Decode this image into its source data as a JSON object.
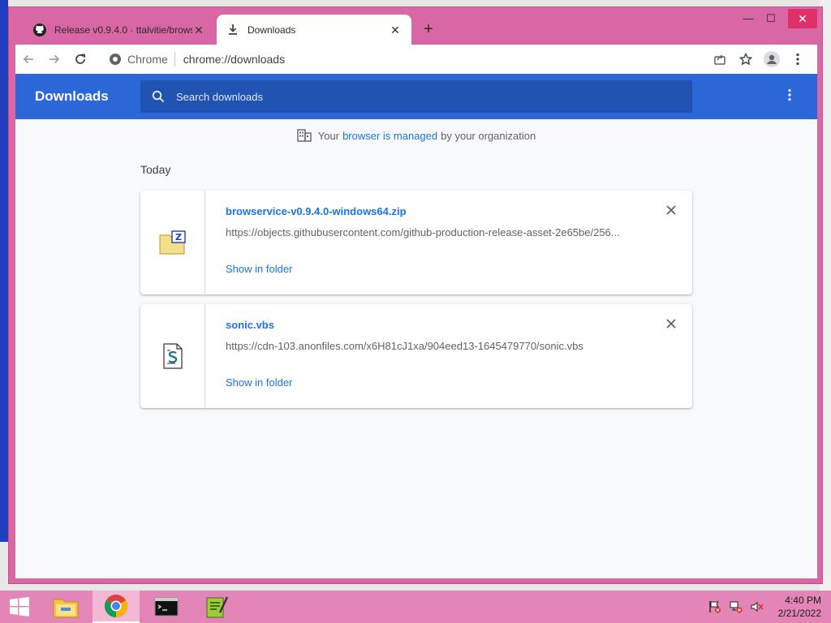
{
  "browser": {
    "tabs": [
      {
        "title": "Release v0.9.4.0 · ttalvitie/browse",
        "icon": "github-icon",
        "active": false
      },
      {
        "title": "Downloads",
        "icon": "download-icon",
        "active": true
      }
    ],
    "address": {
      "site_label": "Chrome",
      "url": "chrome://downloads"
    }
  },
  "downloads_page": {
    "title": "Downloads",
    "search_placeholder": "Search downloads",
    "managed_notice": {
      "prefix": "Your",
      "link": "browser is managed",
      "suffix": "by your organization"
    },
    "date_section": "Today",
    "items": [
      {
        "filename": "browservice-v0.9.4.0-windows64.zip",
        "url": "https://objects.githubusercontent.com/github-production-release-asset-2e65be/256...",
        "action": "Show in folder",
        "file_icon": "zip-file-icon"
      },
      {
        "filename": "sonic.vbs",
        "url": "https://cdn-103.anonfiles.com/x6H81cJ1xa/904eed13-1645479770/sonic.vbs",
        "action": "Show in folder",
        "file_icon": "script-file-icon"
      }
    ]
  },
  "taskbar": {
    "apps": [
      "start-icon",
      "file-explorer-icon",
      "chrome-icon",
      "command-prompt-icon",
      "notepad-plus-plus-icon"
    ],
    "clock": {
      "time": "4:40 PM",
      "date": "2/21/2022"
    }
  },
  "colors": {
    "window_frame": "#d967a5",
    "header_blue": "#2b67d6",
    "link_blue": "#1a73e8",
    "taskbar": "#e386b7"
  }
}
